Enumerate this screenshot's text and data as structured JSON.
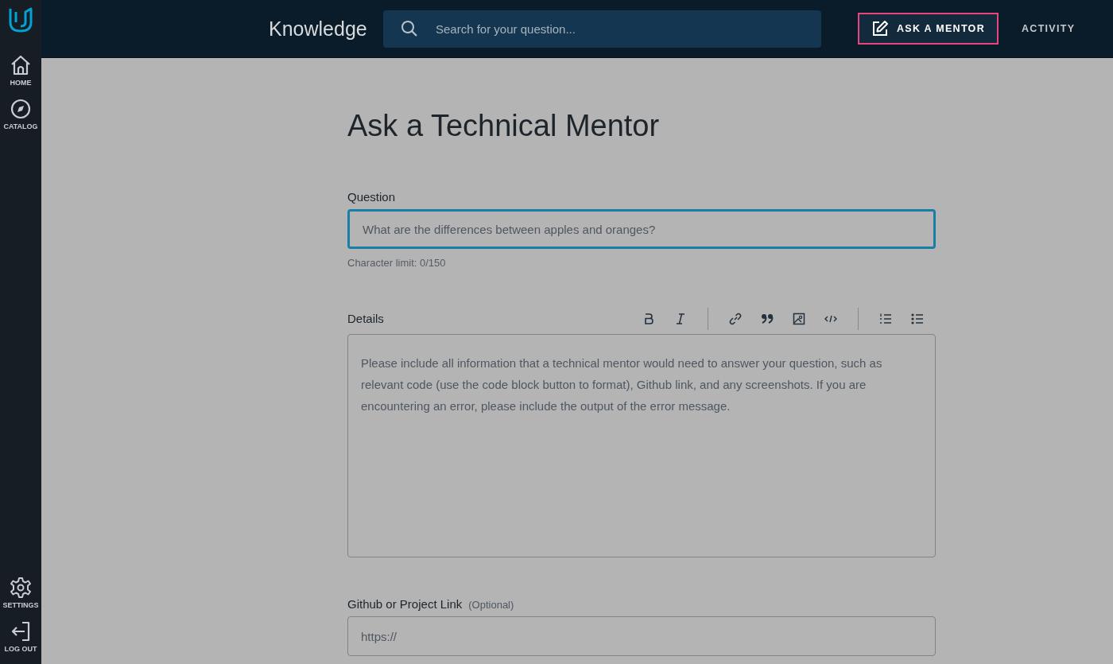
{
  "sidebar": {
    "items": [
      {
        "kind": "home",
        "label": "HOME"
      },
      {
        "kind": "catalog",
        "label": "CATALOG"
      }
    ],
    "bottom_items": [
      {
        "kind": "settings",
        "label": "SETTINGS"
      },
      {
        "kind": "logout",
        "label": "LOG OUT"
      }
    ]
  },
  "header": {
    "title": "Knowledge",
    "search": {
      "placeholder": "Search for your question..."
    },
    "nav": [
      {
        "label": "ASK A MENTOR",
        "icon": true,
        "selected": true
      },
      {
        "label": "ACTIVITY",
        "icon": false,
        "selected": false
      }
    ]
  },
  "page": {
    "title": "Ask a Technical Mentor",
    "question": {
      "label": "Question",
      "placeholder": "What are the differences between apples and oranges?",
      "focused": true,
      "hint": "Character limit: 0/150"
    },
    "details": {
      "label": "Details",
      "toolbar": [
        [
          {
            "kind": "bold"
          },
          {
            "kind": "italic"
          }
        ],
        [
          {
            "kind": "link"
          },
          {
            "kind": "quote"
          },
          {
            "kind": "image"
          },
          {
            "kind": "code"
          }
        ],
        [
          {
            "kind": "ordered-list"
          },
          {
            "kind": "bullet-list"
          }
        ]
      ],
      "placeholder": "Please include all information that a technical mentor would need to answer your question, such as relevant code (use the code block button to format), Github link, and any screenshots. If you are encountering an error, please include the output of the error message."
    },
    "link": {
      "label": "Github or Project Link",
      "note": "(Optional)",
      "placeholder": "https://"
    }
  }
}
